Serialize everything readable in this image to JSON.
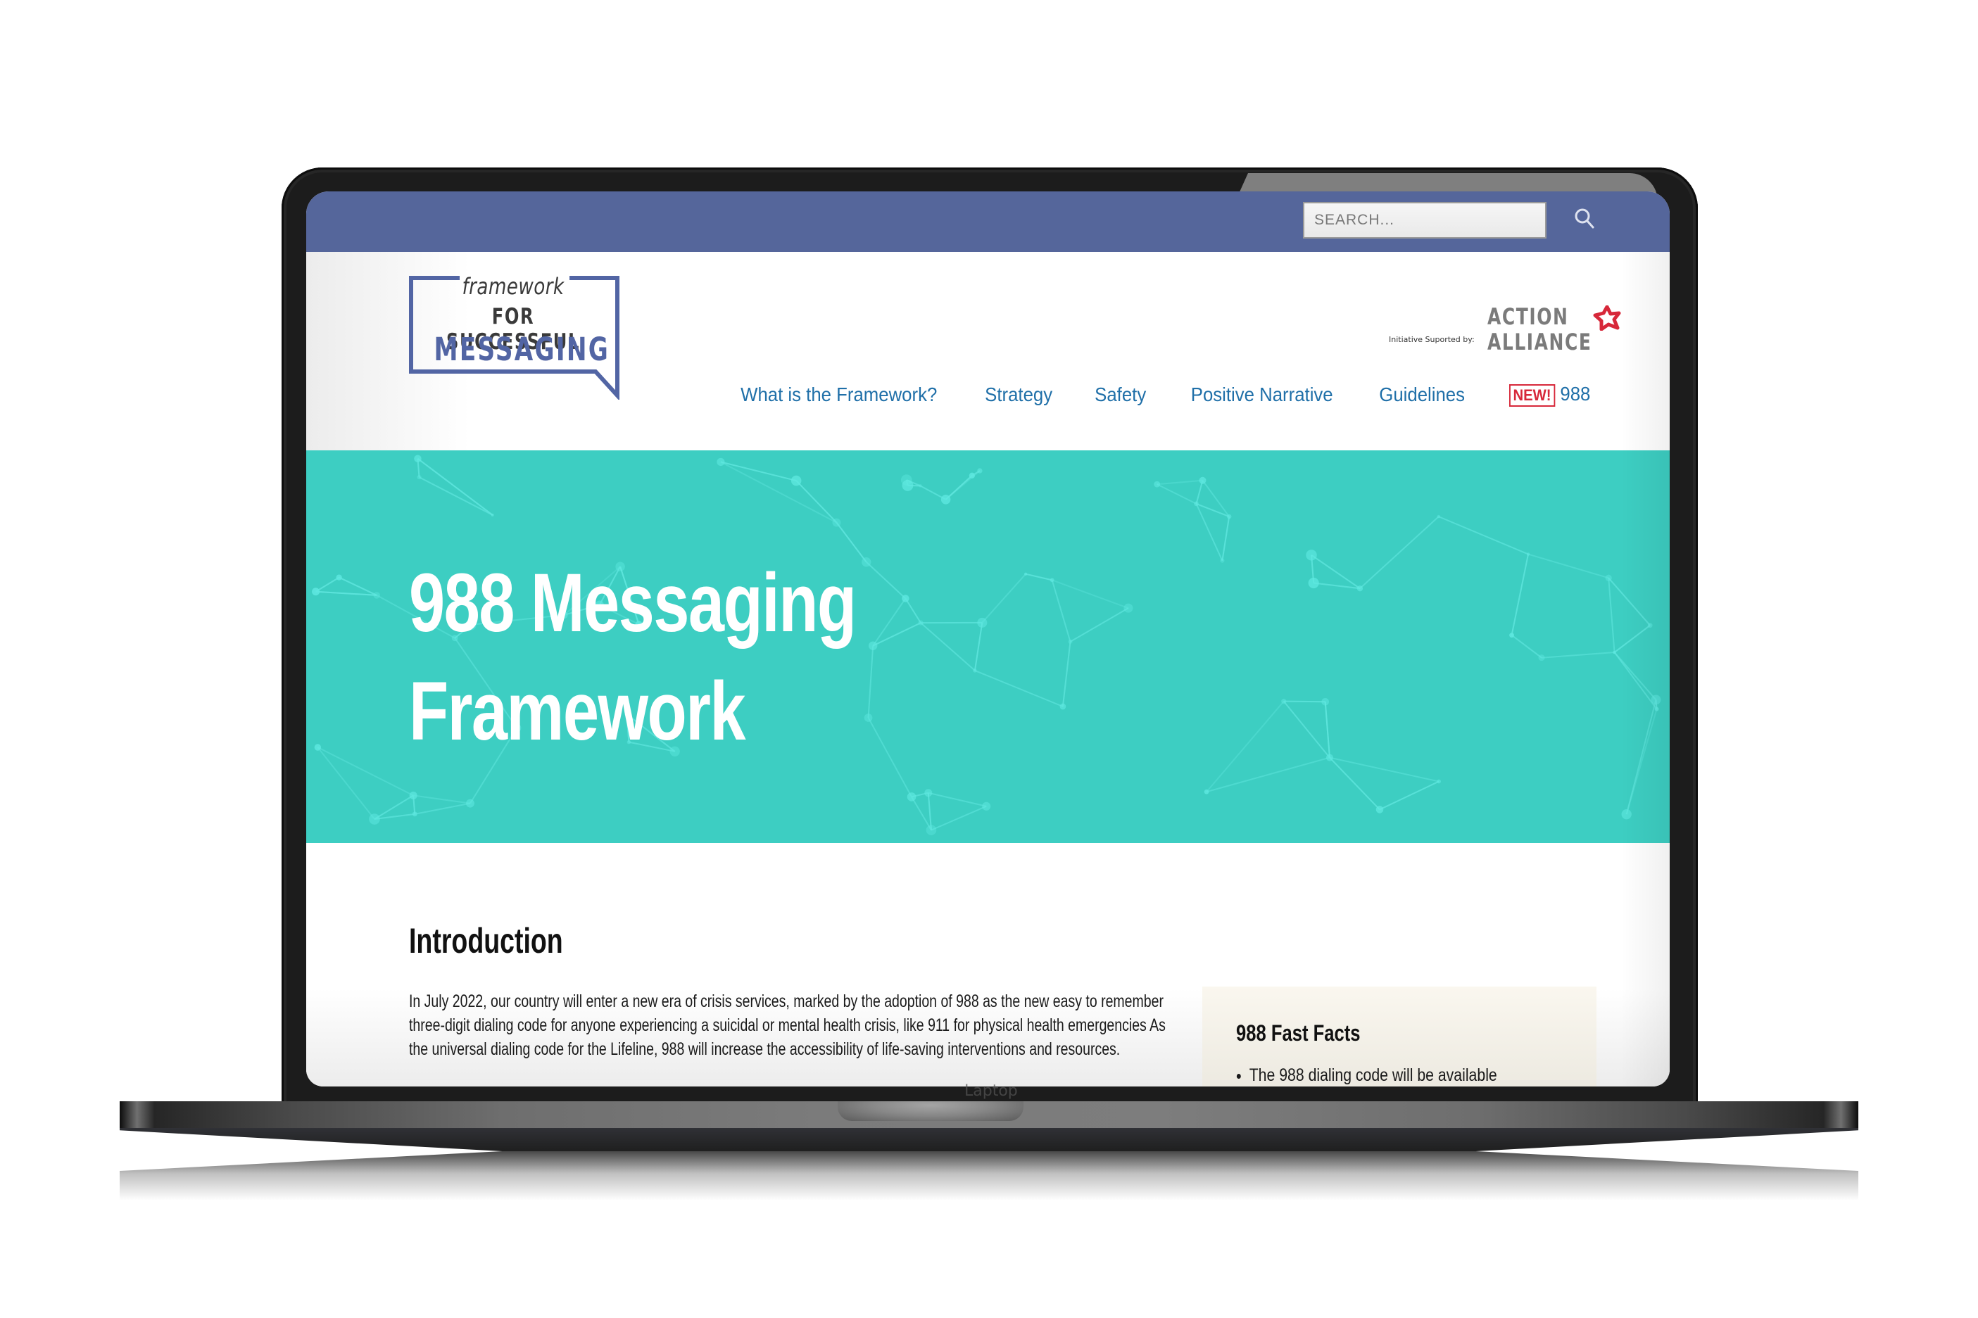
{
  "device": {
    "type": "laptop-mockup",
    "notch_label": "Laptop"
  },
  "topbar": {
    "search_placeholder": "SEARCH...",
    "search_icon": "search-icon",
    "color": "#55669b"
  },
  "header": {
    "logo": {
      "line1": "framework",
      "line2": "FOR SUCCESSFUL",
      "line3": "MESSAGING",
      "color": "#5265a4"
    },
    "partner": {
      "label": "Initiative Suported by:",
      "name_line1": "ACTION",
      "name_line2": "ALLIANCE",
      "icon": "action-alliance-star-icon",
      "icon_color": "#d7283a"
    },
    "nav": {
      "items": [
        {
          "label": "What is the Framework?"
        },
        {
          "label": "Strategy"
        },
        {
          "label": "Safety"
        },
        {
          "label": "Positive Narrative"
        },
        {
          "label": "Guidelines"
        },
        {
          "label": "988",
          "badge": "NEW!"
        }
      ],
      "link_color": "#1f6fa8",
      "badge_color": "#d7283a"
    }
  },
  "hero": {
    "title_line1": "988 Messaging",
    "title_line2": "Framework",
    "background": "#3dcec2"
  },
  "content": {
    "intro_heading": "Introduction",
    "intro_text": "In July 2022, our country will enter a new era of crisis services, marked by the adoption of 988 as the new easy to remember three-digit dialing code for anyone experiencing a suicidal or mental health crisis, like 911 for physical health emergencies As the universal dialing code for the Lifeline, 988 will increase the accessibility of life-saving interventions and resources.",
    "fast_facts": {
      "heading": "988 Fast Facts",
      "items": [
        "The 988 dialing code will be available"
      ]
    }
  }
}
